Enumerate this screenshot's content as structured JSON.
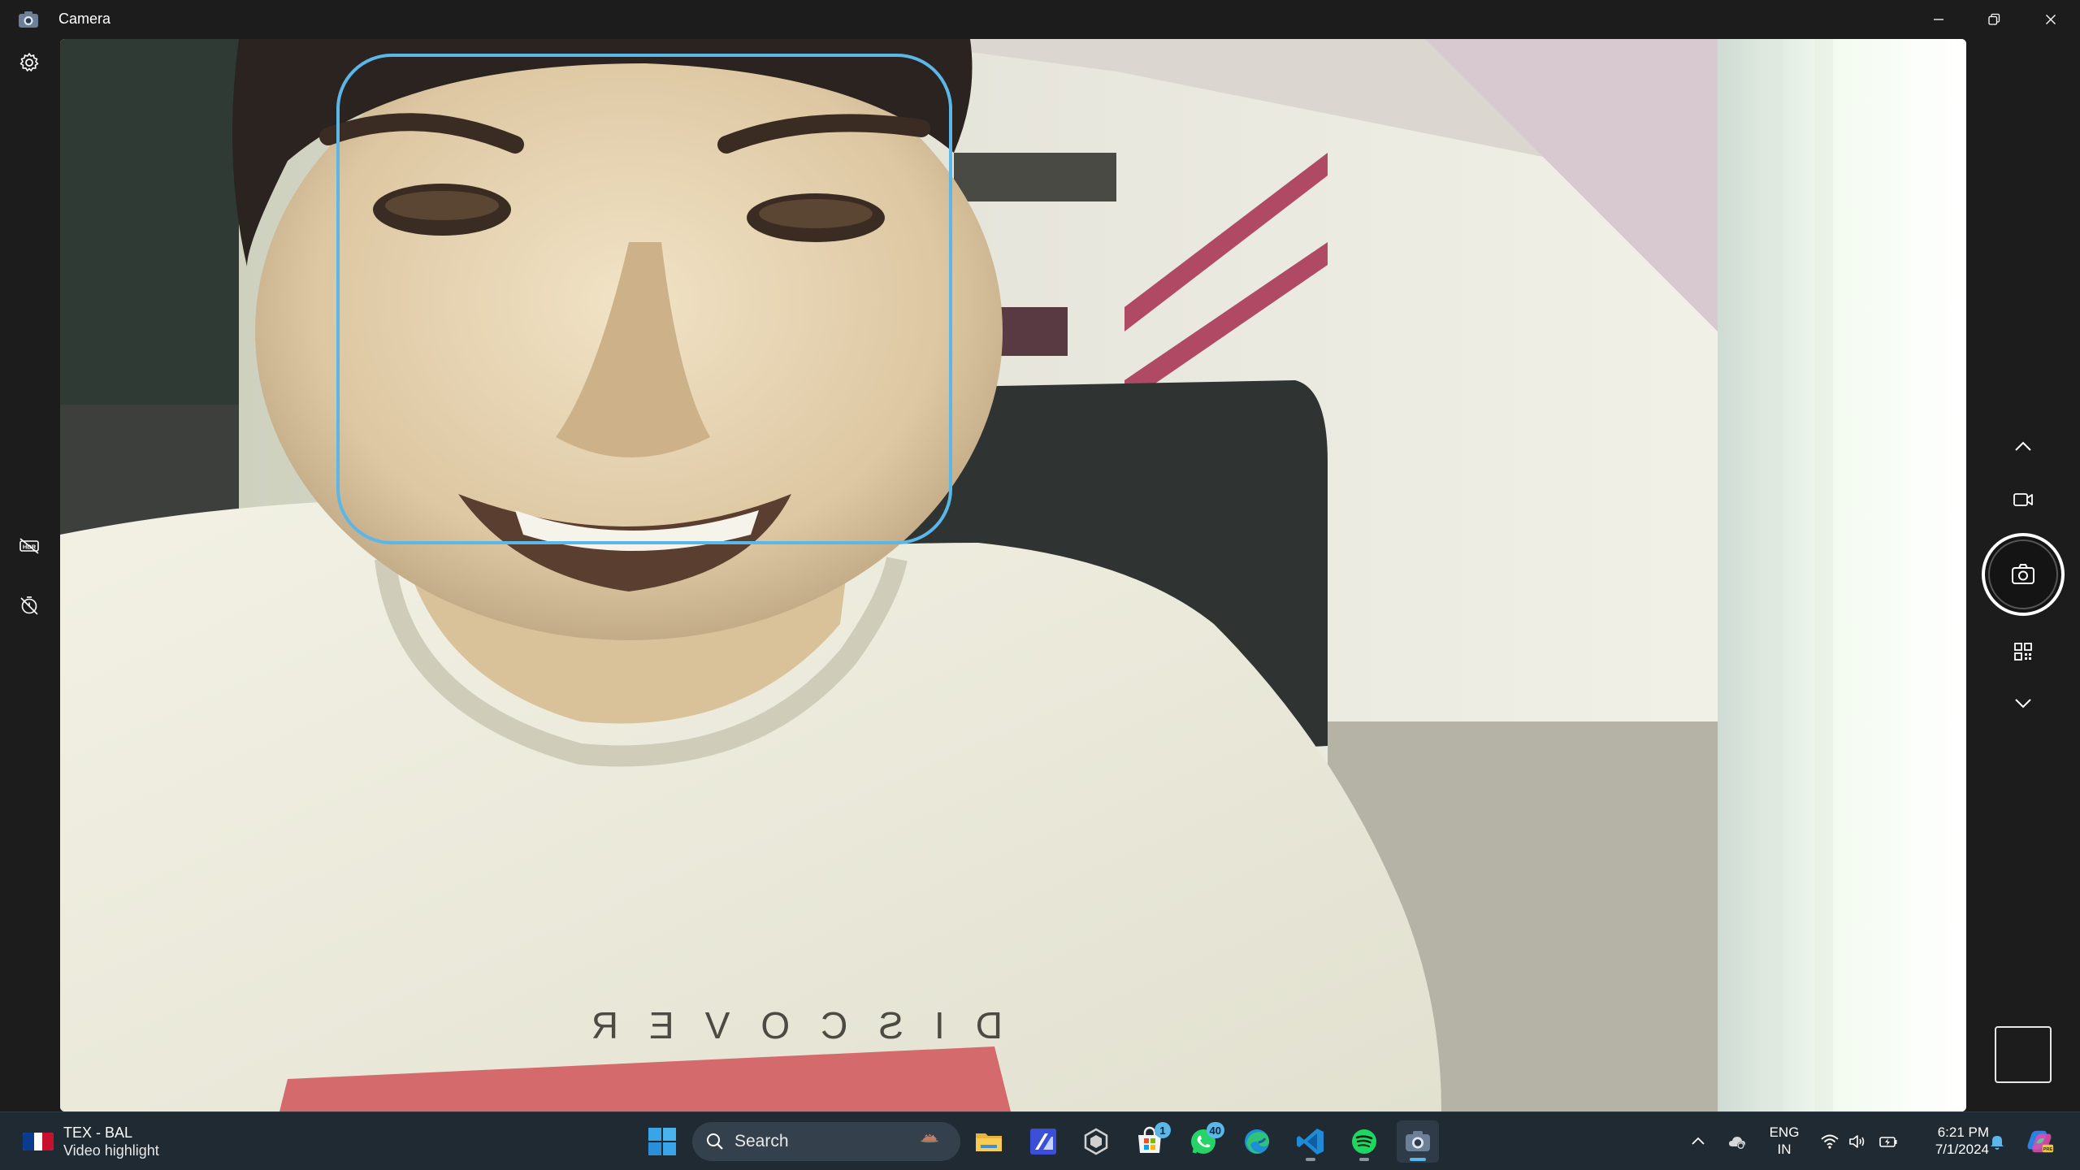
{
  "window": {
    "title": "Camera",
    "controls": {
      "minimize": "minimize-icon",
      "restore": "restore-icon",
      "close": "close-icon"
    }
  },
  "left_rail": {
    "settings": "gear-icon",
    "hdr_off": "hdr-off-icon",
    "timer_off": "timer-off-icon"
  },
  "viewfinder": {
    "face_box_color": "#5ab7e8"
  },
  "right_rail": {
    "mode_up": "chevron-up-icon",
    "video_mode": "video-camera-icon",
    "shutter": "camera-shutter-icon",
    "qr_scan": "qr-code-icon",
    "mode_down": "chevron-down-icon",
    "last_capture": "thumbnail"
  },
  "taskbar": {
    "widget": {
      "line1": "TEX - BAL",
      "line2": "Video highlight",
      "icon": "mlb-logo"
    },
    "search": {
      "label": "Search",
      "icon": "search-icon"
    },
    "apps": [
      {
        "name": "start",
        "icon": "windows-start-icon"
      },
      {
        "name": "file-explorer",
        "icon": "folder-icon"
      },
      {
        "name": "app-blue",
        "icon": "app-icon"
      },
      {
        "name": "unity",
        "icon": "unity-icon"
      },
      {
        "name": "microsoft-store",
        "icon": "store-icon",
        "badge": "1"
      },
      {
        "name": "whatsapp",
        "icon": "whatsapp-icon",
        "badge": "40"
      },
      {
        "name": "edge",
        "icon": "edge-icon"
      },
      {
        "name": "vscode",
        "icon": "vscode-icon"
      },
      {
        "name": "spotify",
        "icon": "spotify-icon"
      },
      {
        "name": "camera",
        "icon": "camera-icon"
      }
    ],
    "tray": {
      "language_line1": "ENG",
      "language_line2": "IN",
      "time": "6:21 PM",
      "date": "7/1/2024"
    }
  },
  "colors": {
    "accent": "#5ab7e8",
    "taskbar_bg": "#1f2a33",
    "window_bg": "#1c1c1c"
  }
}
